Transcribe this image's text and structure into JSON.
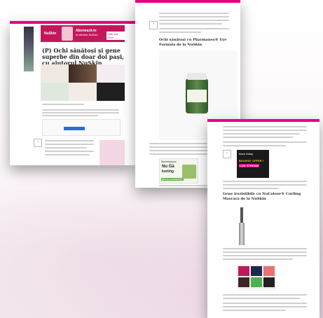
{
  "page1": {
    "banner_brand": "NuSkin",
    "banner_text1": "Abonează-te",
    "banner_text2": "la ofertele NuSkin",
    "banner_cta": "Află mai mult",
    "title": "(P) Ochi sănătoși și gene superbe din doar doi pași, cu ajutorul NuSkin"
  },
  "page2": {
    "heading": "Ochi sănătoși cu Pharmanex® Eye Formula de la NuSkin",
    "ad_brand": "Marketplace",
    "ad_line1": "Nu Gă",
    "ad_line2": "korting",
    "ad_cta": "BEKIJK AANBIEDING"
  },
  "page3": {
    "ad_top": "black friday",
    "ad_line1": "BIGGEST OFFER !",
    "ad_line2": "LIVE STREAM",
    "heading": "Gene irezistibile cu NuColour® Curling Mascara de la NuSkin"
  },
  "colors": {
    "accent": "#e6007e",
    "banner": "#c2185b"
  },
  "icons": {
    "share": "share-icon"
  }
}
